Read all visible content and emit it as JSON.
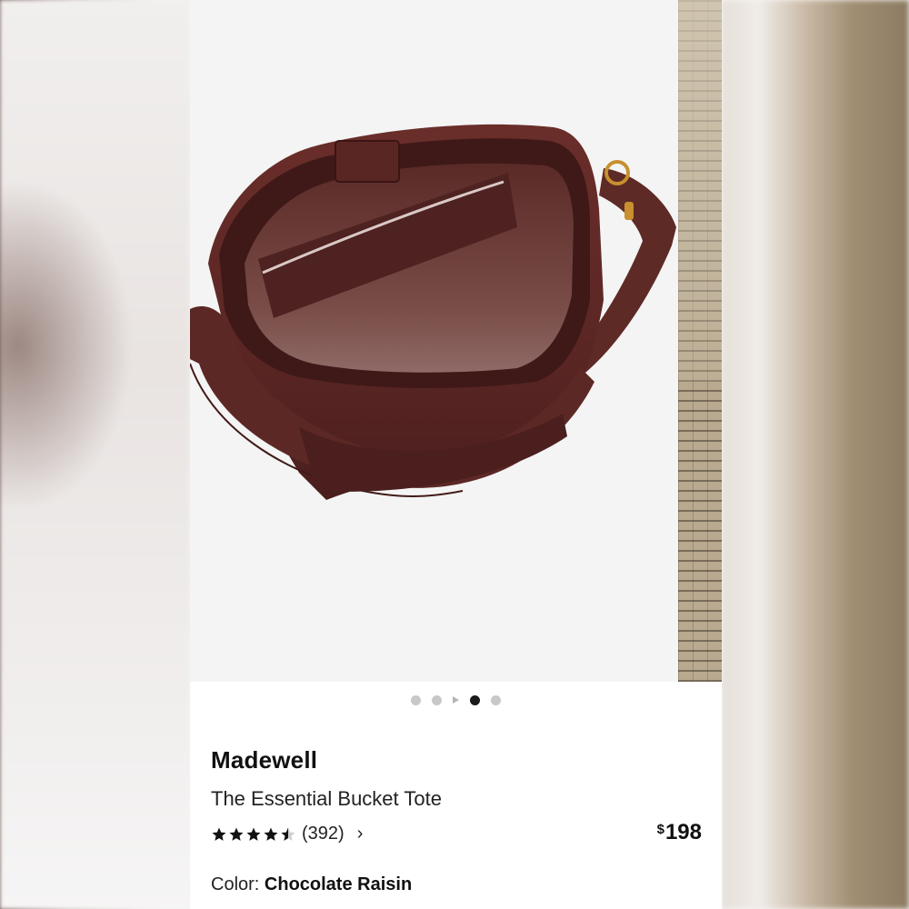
{
  "gallery": {
    "image_alt_icon": "bucket-tote-bag-image",
    "dots": [
      {
        "state": "inactive"
      },
      {
        "state": "inactive"
      },
      {
        "state": "video"
      },
      {
        "state": "active"
      },
      {
        "state": "inactive"
      }
    ]
  },
  "product": {
    "brand": "Madewell",
    "name": "The Essential Bucket Tote",
    "rating": 4.5,
    "review_count": "(392)",
    "chevron": "›",
    "price_currency": "$",
    "price_value": "198",
    "color_label": "Color:",
    "color_value": "Chocolate Raisin"
  },
  "colors": {
    "bag": "#5e2a26",
    "active_dot": "#1a1a1a",
    "inactive_dot": "#c8c8c8"
  }
}
